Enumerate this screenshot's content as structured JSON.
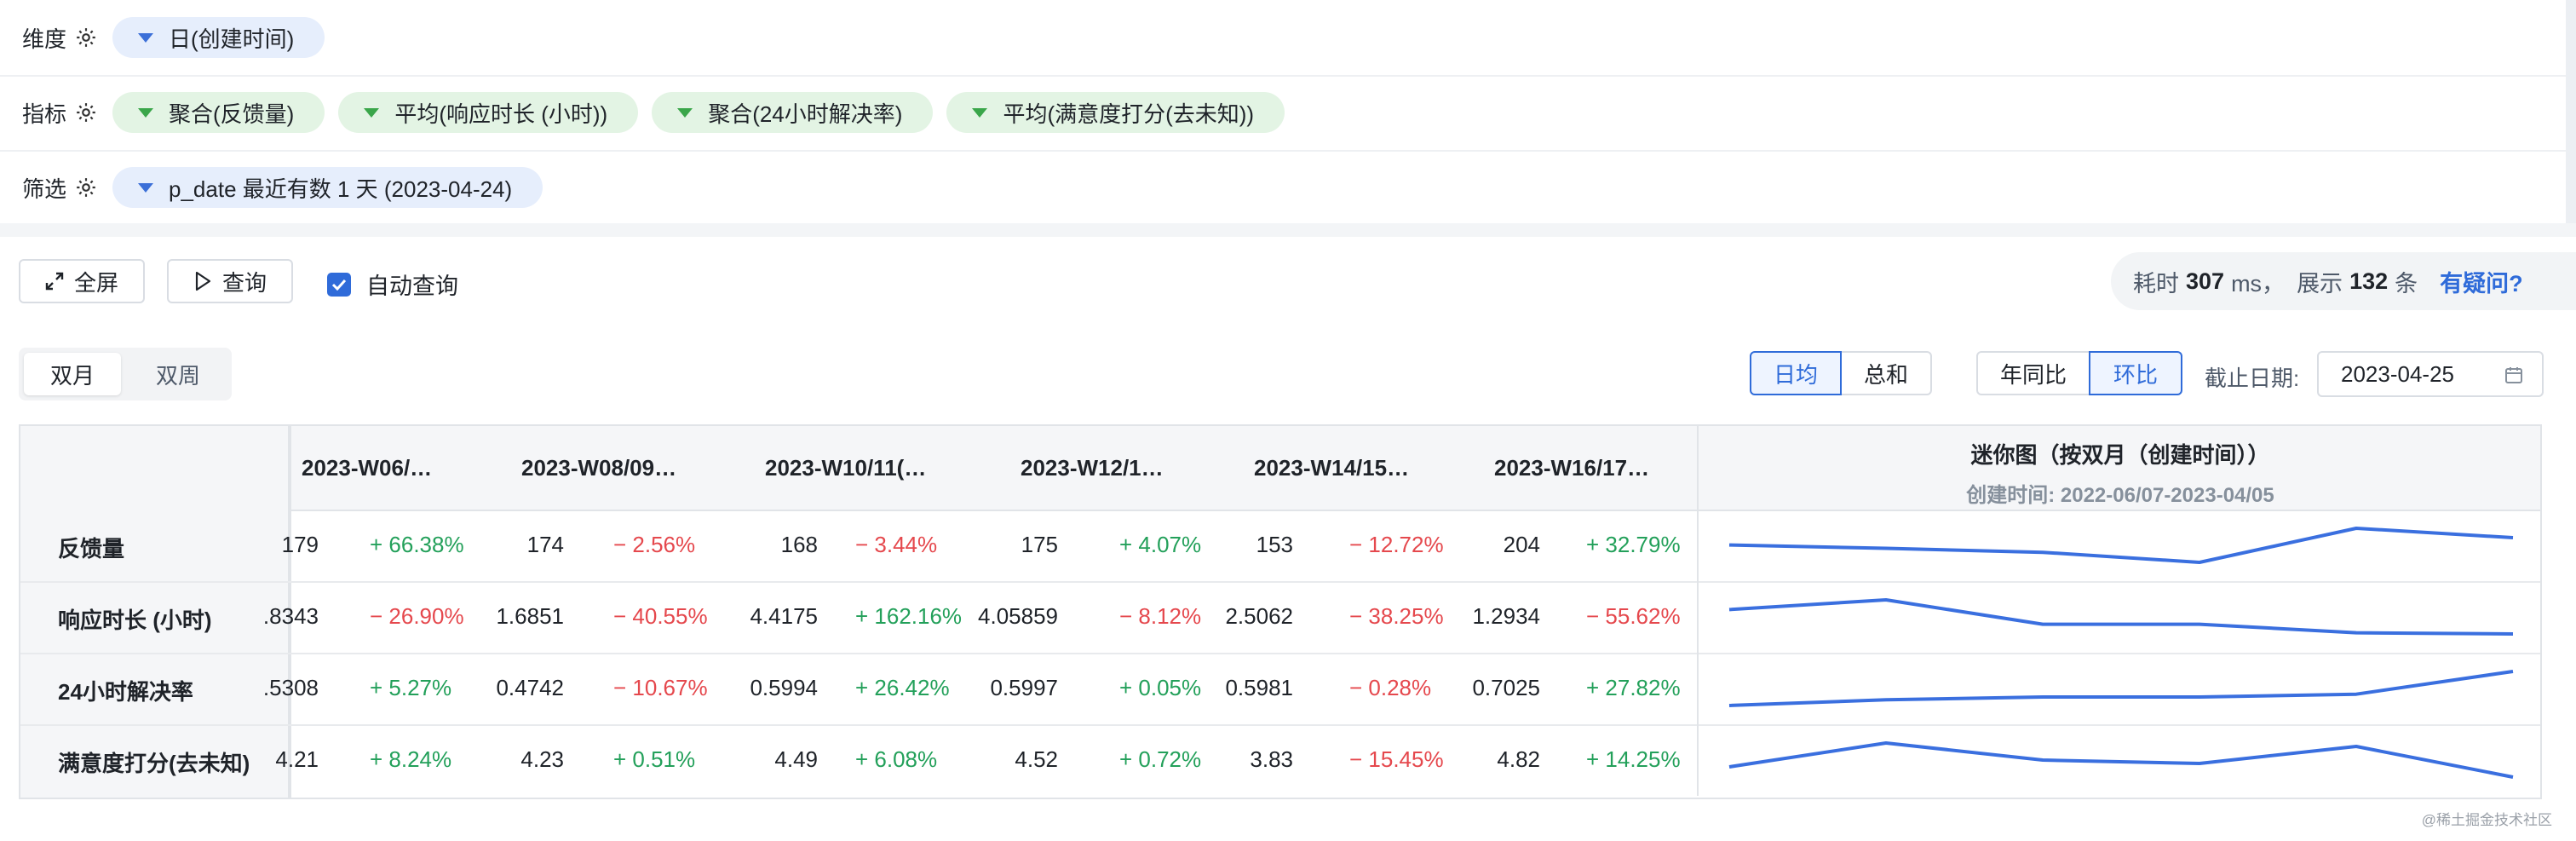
{
  "config": {
    "dimension": {
      "label": "维度",
      "chips": [
        "日(创建时间)"
      ]
    },
    "metrics": {
      "label": "指标",
      "chips": [
        "聚合(反馈量)",
        "平均(响应时长 (小时))",
        "聚合(24小时解决率)",
        "平均(满意度打分(去未知))"
      ]
    },
    "filter": {
      "label": "筛选",
      "chips": [
        "p_date 最近有数 1 天 (2023-04-24)"
      ]
    }
  },
  "toolbar": {
    "fullscreen_label": "全屏",
    "query_label": "查询",
    "auto_query_label": "自动查询",
    "auto_query_checked": true,
    "info": {
      "prefix": "耗时",
      "ms": "307",
      "ms_unit": "ms，",
      "show": "展示",
      "count": "132",
      "count_unit": "条",
      "help": "有疑问?"
    }
  },
  "period_tabs": {
    "items": [
      "双月",
      "双周"
    ],
    "active": "双月"
  },
  "avg_toggle": {
    "items": [
      "日均",
      "总和"
    ],
    "active": "日均"
  },
  "compare_toggle": {
    "items": [
      "年同比",
      "环比"
    ],
    "active": "环比"
  },
  "cutoff": {
    "label": "截止日期:",
    "value": "2023-04-25"
  },
  "table": {
    "columns": [
      "2023-W06/…",
      "2023-W08/09…",
      "2023-W10/11(…",
      "2023-W12/1…",
      "2023-W14/15…",
      "2023-W16/17…"
    ],
    "spark_title": "迷你图（按双月（创建时间））",
    "spark_range": "创建时间: 2022-06/07-2023-04/05",
    "rows": [
      {
        "label": "反馈量",
        "cells": [
          {
            "v": "179",
            "d": "+ 66.38%",
            "dir": "up"
          },
          {
            "v": "174",
            "d": "− 2.56%",
            "dir": "down"
          },
          {
            "v": "168",
            "d": "− 3.44%",
            "dir": "down"
          },
          {
            "v": "175",
            "d": "+ 4.07%",
            "dir": "up"
          },
          {
            "v": "153",
            "d": "− 12.72%",
            "dir": "down"
          },
          {
            "v": "204",
            "d": "+ 32.79%",
            "dir": "up"
          }
        ],
        "spark": [
          179,
          174,
          168,
          153,
          204,
          190
        ]
      },
      {
        "label": "响应时长 (小时)",
        "cells": [
          {
            "v": ".8343",
            "d": "− 26.90%",
            "dir": "down"
          },
          {
            "v": "1.6851",
            "d": "− 40.55%",
            "dir": "down"
          },
          {
            "v": "4.4175",
            "d": "+ 162.16%",
            "dir": "up"
          },
          {
            "v": "4.05859",
            "d": "− 8.12%",
            "dir": "down"
          },
          {
            "v": "2.5062",
            "d": "− 38.25%",
            "dir": "down"
          },
          {
            "v": "1.2934",
            "d": "− 55.62%",
            "dir": "down"
          }
        ],
        "spark": [
          5.6,
          6.4,
          4.4,
          4.4,
          3.7,
          3.6
        ]
      },
      {
        "label": "24小时解决率",
        "cells": [
          {
            "v": ".5308",
            "d": "+ 5.27%",
            "dir": "up"
          },
          {
            "v": "0.4742",
            "d": "− 10.67%",
            "dir": "down"
          },
          {
            "v": "0.5994",
            "d": "+ 26.42%",
            "dir": "up"
          },
          {
            "v": "0.5997",
            "d": "+ 0.05%",
            "dir": "up"
          },
          {
            "v": "0.5981",
            "d": "− 0.28%",
            "dir": "down"
          },
          {
            "v": "0.7025",
            "d": "+ 27.82%",
            "dir": "up"
          }
        ],
        "spark": [
          0.46,
          0.5,
          0.52,
          0.52,
          0.54,
          0.7
        ]
      },
      {
        "label": "满意度打分(去未知)",
        "cells": [
          {
            "v": "4.21",
            "d": "+ 8.24%",
            "dir": "up"
          },
          {
            "v": "4.23",
            "d": "+ 0.51%",
            "dir": "up"
          },
          {
            "v": "4.49",
            "d": "+ 6.08%",
            "dir": "up"
          },
          {
            "v": "4.52",
            "d": "+ 0.72%",
            "dir": "up"
          },
          {
            "v": "3.83",
            "d": "− 15.45%",
            "dir": "down"
          },
          {
            "v": "4.82",
            "d": "+ 14.25%",
            "dir": "up"
          }
        ],
        "spark": [
          3.9,
          4.6,
          4.1,
          4.0,
          4.5,
          3.6
        ]
      }
    ]
  },
  "watermark": "@稀土掘金技术社区",
  "colors": {
    "accent": "#2f6bd9",
    "up": "#23a05a",
    "down": "#e5484d",
    "spark_line": "#3a6fdf"
  }
}
